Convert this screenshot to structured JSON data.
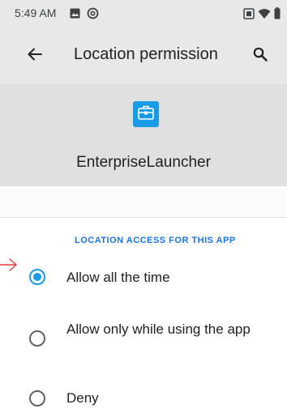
{
  "status_bar": {
    "time": "5:49 AM",
    "left_icons": [
      "image-icon",
      "at-sign-icon"
    ],
    "right_icons": [
      "sim-icon",
      "wifi-icon",
      "battery-icon"
    ]
  },
  "app_bar": {
    "back_icon": "arrow-left-icon",
    "title": "Location permission",
    "search_icon": "search-icon"
  },
  "app_header": {
    "icon": "briefcase-icon",
    "icon_color": "#1a9be8",
    "app_name": "EnterpriseLauncher"
  },
  "section": {
    "header": "LOCATION ACCESS FOR THIS APP"
  },
  "options": [
    {
      "label": "Allow all the time",
      "selected": true
    },
    {
      "label": "Allow only while using the app",
      "selected": false
    },
    {
      "label": "Deny",
      "selected": false
    }
  ],
  "colors": {
    "accent": "#1a9be8",
    "section_header": "#1a73e8",
    "pointer": "#e53935"
  }
}
